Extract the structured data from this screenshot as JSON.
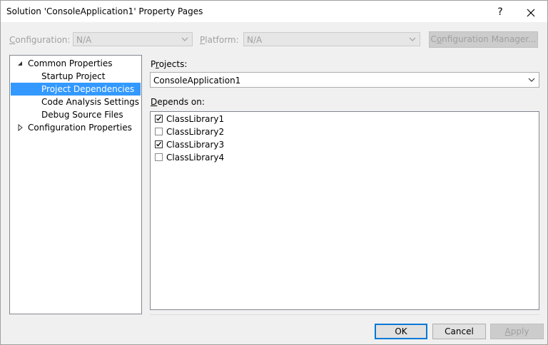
{
  "window": {
    "title": "Solution 'ConsoleApplication1' Property Pages",
    "help_glyph": "?",
    "close_glyph": "✕"
  },
  "config_row": {
    "configuration_label_prefix": "",
    "configuration_label_accel": "C",
    "configuration_label_rest": "onfiguration:",
    "configuration_value": "N/A",
    "platform_label_accel": "P",
    "platform_label_rest": "latform:",
    "platform_value": "N/A",
    "config_manager_accel": "o",
    "config_manager_before": "C",
    "config_manager_after": "nfiguration Manager..."
  },
  "tree": {
    "items": [
      {
        "label": "Common Properties",
        "expander": "expanded",
        "level": 0
      },
      {
        "label": "Startup Project",
        "level": 1
      },
      {
        "label": "Project Dependencies",
        "level": 1,
        "selected": true
      },
      {
        "label": "Code Analysis Settings",
        "level": 1
      },
      {
        "label": "Debug Source Files",
        "level": 1
      },
      {
        "label": "Configuration Properties",
        "expander": "collapsed",
        "level": 0
      }
    ]
  },
  "projects": {
    "label_accel": "r",
    "label_before": "P",
    "label_after": "ojects:",
    "selected_value": "ConsoleApplication1"
  },
  "depends_on": {
    "label_accel": "D",
    "label_rest": "epends on:",
    "items": [
      {
        "label": "ClassLibrary1",
        "checked": true
      },
      {
        "label": "ClassLibrary2",
        "checked": false
      },
      {
        "label": "ClassLibrary3",
        "checked": true
      },
      {
        "label": "ClassLibrary4",
        "checked": false
      }
    ]
  },
  "buttons": {
    "ok": "OK",
    "cancel": "Cancel",
    "apply_accel": "A",
    "apply_rest": "pply"
  },
  "colors": {
    "selection": "#3399ff",
    "default_button_border": "#0078d7"
  }
}
